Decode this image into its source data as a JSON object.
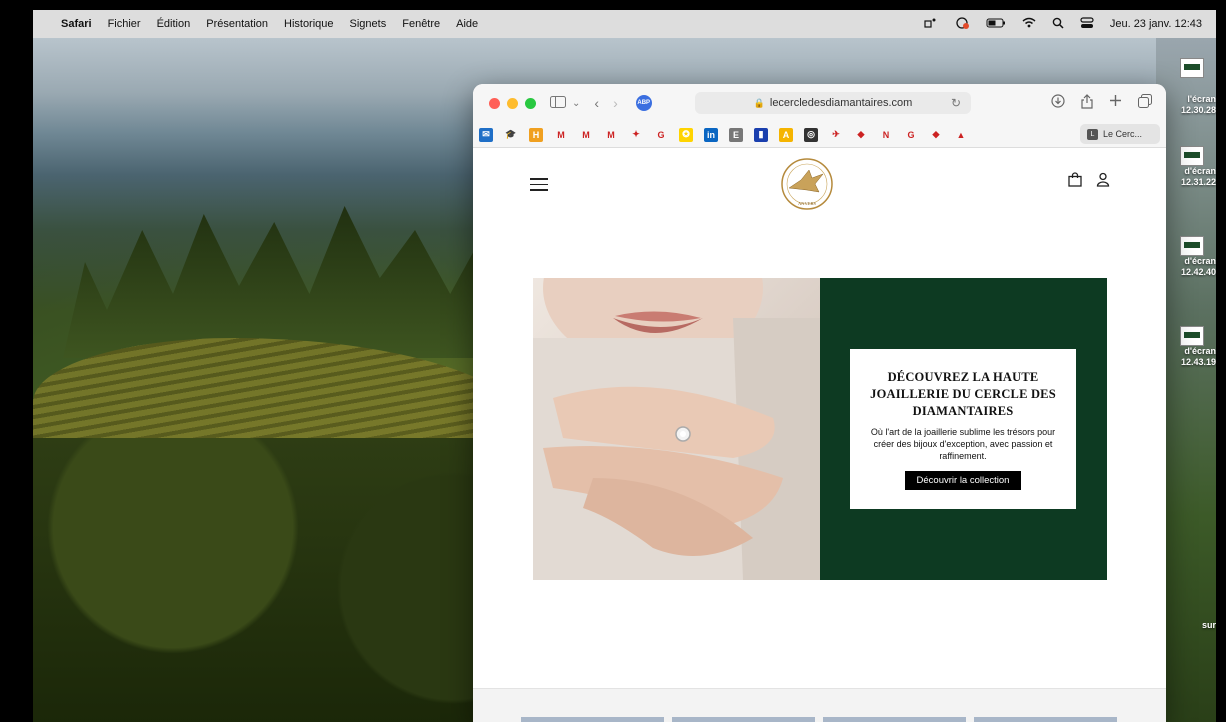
{
  "menubar": {
    "app": "Safari",
    "items": [
      "Fichier",
      "Édition",
      "Présentation",
      "Historique",
      "Signets",
      "Fenêtre",
      "Aide"
    ],
    "clock": "Jeu. 23 janv.  12:43"
  },
  "desktop_icons": [
    {
      "label1": "",
      "label2": ""
    },
    {
      "label1": "l'écran",
      "label2": "12.30.28"
    },
    {
      "label1": "d'écran",
      "label2": "12.31.22"
    },
    {
      "label1": "d'écran",
      "label2": "12.42.40"
    },
    {
      "label1": "d'écran",
      "label2": "12.43.19"
    },
    {
      "label1": "sur",
      "label2": ""
    }
  ],
  "browser": {
    "abp_label": "ABP",
    "url": "lecercledesdiamantaires.com",
    "favorites": [
      {
        "glyph": "✉",
        "color": "#1f6fc7"
      },
      {
        "glyph": "🎓",
        "color": "#ffffff"
      },
      {
        "glyph": "H",
        "color": "#f0a020"
      },
      {
        "glyph": "M",
        "color": "#ffffff"
      },
      {
        "glyph": "M",
        "color": "#ffffff"
      },
      {
        "glyph": "M",
        "color": "#ffffff"
      },
      {
        "glyph": "✦",
        "color": "#ffffff"
      },
      {
        "glyph": "G",
        "color": "#ffffff"
      },
      {
        "glyph": "✪",
        "color": "#ffd400"
      },
      {
        "glyph": "in",
        "color": "#0a66c2"
      },
      {
        "glyph": "E",
        "color": "#777777"
      },
      {
        "glyph": "▮",
        "color": "#1a3fae"
      },
      {
        "glyph": "A",
        "color": "#f5b400"
      },
      {
        "glyph": "◎",
        "color": "#333333"
      },
      {
        "glyph": "✈",
        "color": "#ffffff"
      },
      {
        "glyph": "◆",
        "color": "#ffffff"
      },
      {
        "glyph": "N",
        "color": "#ffffff"
      },
      {
        "glyph": "G",
        "color": "#ffffff"
      },
      {
        "glyph": "◆",
        "color": "#ffffff"
      },
      {
        "glyph": "▲",
        "color": "#ffffff"
      }
    ],
    "tab_title": "Le Cerc..."
  },
  "site": {
    "logo_text": "ANVERS",
    "promo_title": "DÉCOUVREZ LA HAUTE JOAILLERIE DU CERCLE DES DIAMANTAIRES",
    "promo_text": "Où l'art de la joaillerie sublime les trésors pour créer des bijoux d'exception, avec passion et raffinement.",
    "cta": "Découvrir la collection"
  },
  "colors": {
    "accent_green": "#0d3a22",
    "cta_bg": "#000000"
  }
}
